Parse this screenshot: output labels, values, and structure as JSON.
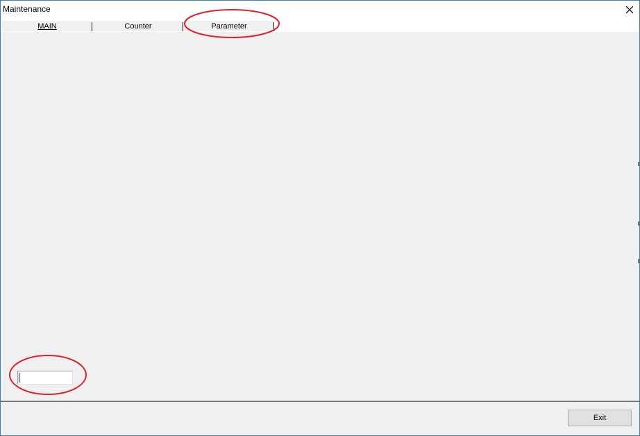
{
  "window": {
    "title": "Maintenance",
    "close_icon": "close-icon"
  },
  "tabs": [
    {
      "label": "MAIN",
      "selected": false
    },
    {
      "label": "Counter",
      "selected": false
    },
    {
      "label": "Parameter",
      "selected": true
    }
  ],
  "parameter_page": {
    "value_field": ""
  },
  "footer": {
    "exit_label": "Exit"
  },
  "annotations": {
    "color": "#d9232d",
    "highlighted": [
      "Parameter tab",
      "value field"
    ]
  }
}
